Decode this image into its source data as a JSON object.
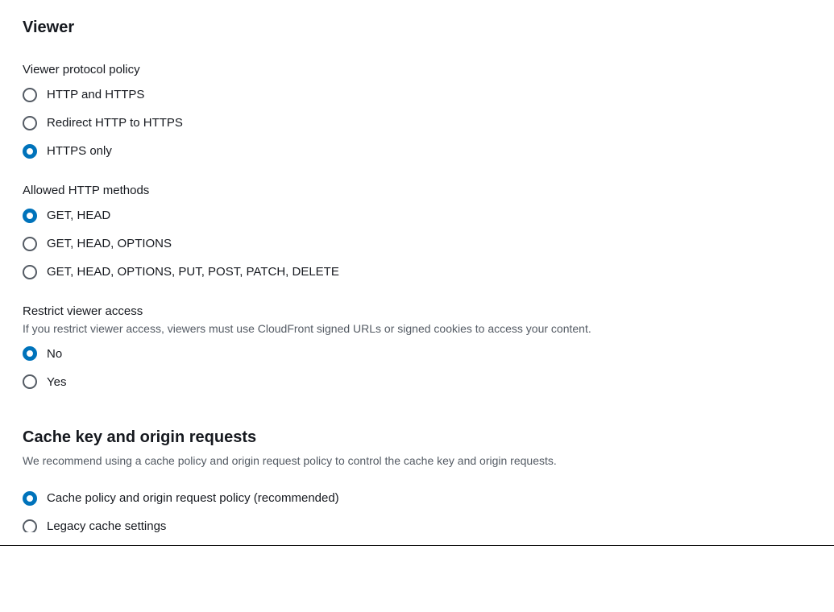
{
  "viewer": {
    "heading": "Viewer",
    "protocol_policy": {
      "label": "Viewer protocol policy",
      "options": [
        {
          "label": "HTTP and HTTPS",
          "selected": false
        },
        {
          "label": "Redirect HTTP to HTTPS",
          "selected": false
        },
        {
          "label": "HTTPS only",
          "selected": true
        }
      ]
    },
    "allowed_methods": {
      "label": "Allowed HTTP methods",
      "options": [
        {
          "label": "GET, HEAD",
          "selected": true
        },
        {
          "label": "GET, HEAD, OPTIONS",
          "selected": false
        },
        {
          "label": "GET, HEAD, OPTIONS, PUT, POST, PATCH, DELETE",
          "selected": false
        }
      ]
    },
    "restrict_access": {
      "label": "Restrict viewer access",
      "helper": "If you restrict viewer access, viewers must use CloudFront signed URLs or signed cookies to access your content.",
      "options": [
        {
          "label": "No",
          "selected": true
        },
        {
          "label": "Yes",
          "selected": false
        }
      ]
    }
  },
  "cache": {
    "heading": "Cache key and origin requests",
    "subtext": "We recommend using a cache policy and origin request policy to control the cache key and origin requests.",
    "options": [
      {
        "label": "Cache policy and origin request policy (recommended)",
        "selected": true
      },
      {
        "label": "Legacy cache settings",
        "selected": false
      }
    ]
  }
}
